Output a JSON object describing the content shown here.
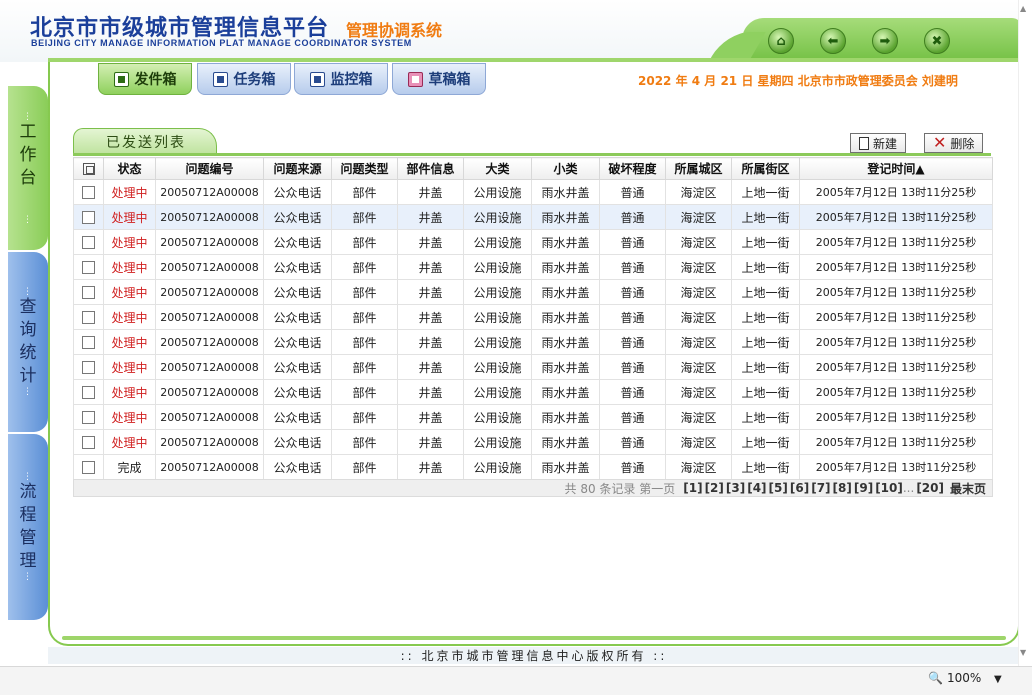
{
  "header": {
    "title": "北京市市级城市管理信息平台",
    "subtitle": "管理协调系统",
    "english": "BEIJING CITY MANAGE INFORMATION PLAT MANAGE COORDINATOR SYSTEM",
    "nav_buttons": [
      {
        "icon": "home-icon",
        "glyph": "⌂"
      },
      {
        "icon": "back-arrow-icon",
        "glyph": "⬅"
      },
      {
        "icon": "forward-arrow-icon",
        "glyph": "➡"
      },
      {
        "icon": "close-icon",
        "glyph": "✖"
      }
    ]
  },
  "top_tabs": [
    {
      "label": "发件箱",
      "active": true
    },
    {
      "label": "任务箱",
      "active": false
    },
    {
      "label": "监控箱",
      "active": false
    },
    {
      "label": "草稿箱",
      "active": false
    }
  ],
  "date_user": "2022 年 4 月 21 日 星期四    北京市市政管理委员会 刘建明",
  "sidebar": [
    {
      "label": "工作台",
      "chars": [
        "工",
        "作",
        "台"
      ]
    },
    {
      "label": "查询统计",
      "chars": [
        "查",
        "询",
        "统",
        "计"
      ]
    },
    {
      "label": "流程管理",
      "chars": [
        "流",
        "程",
        "管",
        "理"
      ]
    }
  ],
  "list": {
    "tab_label": "已发送列表",
    "new_button": "新建",
    "delete_button": "删除",
    "columns": [
      "状态",
      "问题编号",
      "问题来源",
      "问题类型",
      "部件信息",
      "大类",
      "小类",
      "破坏程度",
      "所属城区",
      "所属街区",
      "登记时间▲"
    ],
    "rows": [
      [
        "处理中",
        "20050712A00008",
        "公众电话",
        "部件",
        "井盖",
        "公用设施",
        "雨水井盖",
        "普通",
        "海淀区",
        "上地一街",
        "2005年7月12日 13时11分25秒"
      ],
      [
        "处理中",
        "20050712A00008",
        "公众电话",
        "部件",
        "井盖",
        "公用设施",
        "雨水井盖",
        "普通",
        "海淀区",
        "上地一街",
        "2005年7月12日 13时11分25秒"
      ],
      [
        "处理中",
        "20050712A00008",
        "公众电话",
        "部件",
        "井盖",
        "公用设施",
        "雨水井盖",
        "普通",
        "海淀区",
        "上地一街",
        "2005年7月12日 13时11分25秒"
      ],
      [
        "处理中",
        "20050712A00008",
        "公众电话",
        "部件",
        "井盖",
        "公用设施",
        "雨水井盖",
        "普通",
        "海淀区",
        "上地一街",
        "2005年7月12日 13时11分25秒"
      ],
      [
        "处理中",
        "20050712A00008",
        "公众电话",
        "部件",
        "井盖",
        "公用设施",
        "雨水井盖",
        "普通",
        "海淀区",
        "上地一街",
        "2005年7月12日 13时11分25秒"
      ],
      [
        "处理中",
        "20050712A00008",
        "公众电话",
        "部件",
        "井盖",
        "公用设施",
        "雨水井盖",
        "普通",
        "海淀区",
        "上地一街",
        "2005年7月12日 13时11分25秒"
      ],
      [
        "处理中",
        "20050712A00008",
        "公众电话",
        "部件",
        "井盖",
        "公用设施",
        "雨水井盖",
        "普通",
        "海淀区",
        "上地一街",
        "2005年7月12日 13时11分25秒"
      ],
      [
        "处理中",
        "20050712A00008",
        "公众电话",
        "部件",
        "井盖",
        "公用设施",
        "雨水井盖",
        "普通",
        "海淀区",
        "上地一街",
        "2005年7月12日 13时11分25秒"
      ],
      [
        "处理中",
        "20050712A00008",
        "公众电话",
        "部件",
        "井盖",
        "公用设施",
        "雨水井盖",
        "普通",
        "海淀区",
        "上地一街",
        "2005年7月12日 13时11分25秒"
      ],
      [
        "处理中",
        "20050712A00008",
        "公众电话",
        "部件",
        "井盖",
        "公用设施",
        "雨水井盖",
        "普通",
        "海淀区",
        "上地一街",
        "2005年7月12日 13时11分25秒"
      ],
      [
        "处理中",
        "20050712A00008",
        "公众电话",
        "部件",
        "井盖",
        "公用设施",
        "雨水井盖",
        "普通",
        "海淀区",
        "上地一街",
        "2005年7月12日 13时11分25秒"
      ],
      [
        "完成",
        "20050712A00008",
        "公众电话",
        "部件",
        "井盖",
        "公用设施",
        "雨水井盖",
        "普通",
        "海淀区",
        "上地一街",
        "2005年7月12日 13时11分25秒"
      ]
    ],
    "highlighted_row": 1
  },
  "pager": {
    "summary": "共 80 条记录 第一页",
    "pages": [
      "[1]",
      "[2]",
      "[3]",
      "[4]",
      "[5]",
      "[6]",
      "[7]",
      "[8]",
      "[9]",
      "[10]"
    ],
    "ellipsis": "...",
    "last_page": "[20]",
    "last_label": "最末页"
  },
  "footer": "::  北京市城市管理信息中心版权所有  ::",
  "status": {
    "zoom": "100%"
  },
  "colors": {
    "brand_blue": "#1b3f9a",
    "accent_orange": "#f07c12",
    "frame_green": "#86c94f",
    "status_red": "#d02020"
  }
}
